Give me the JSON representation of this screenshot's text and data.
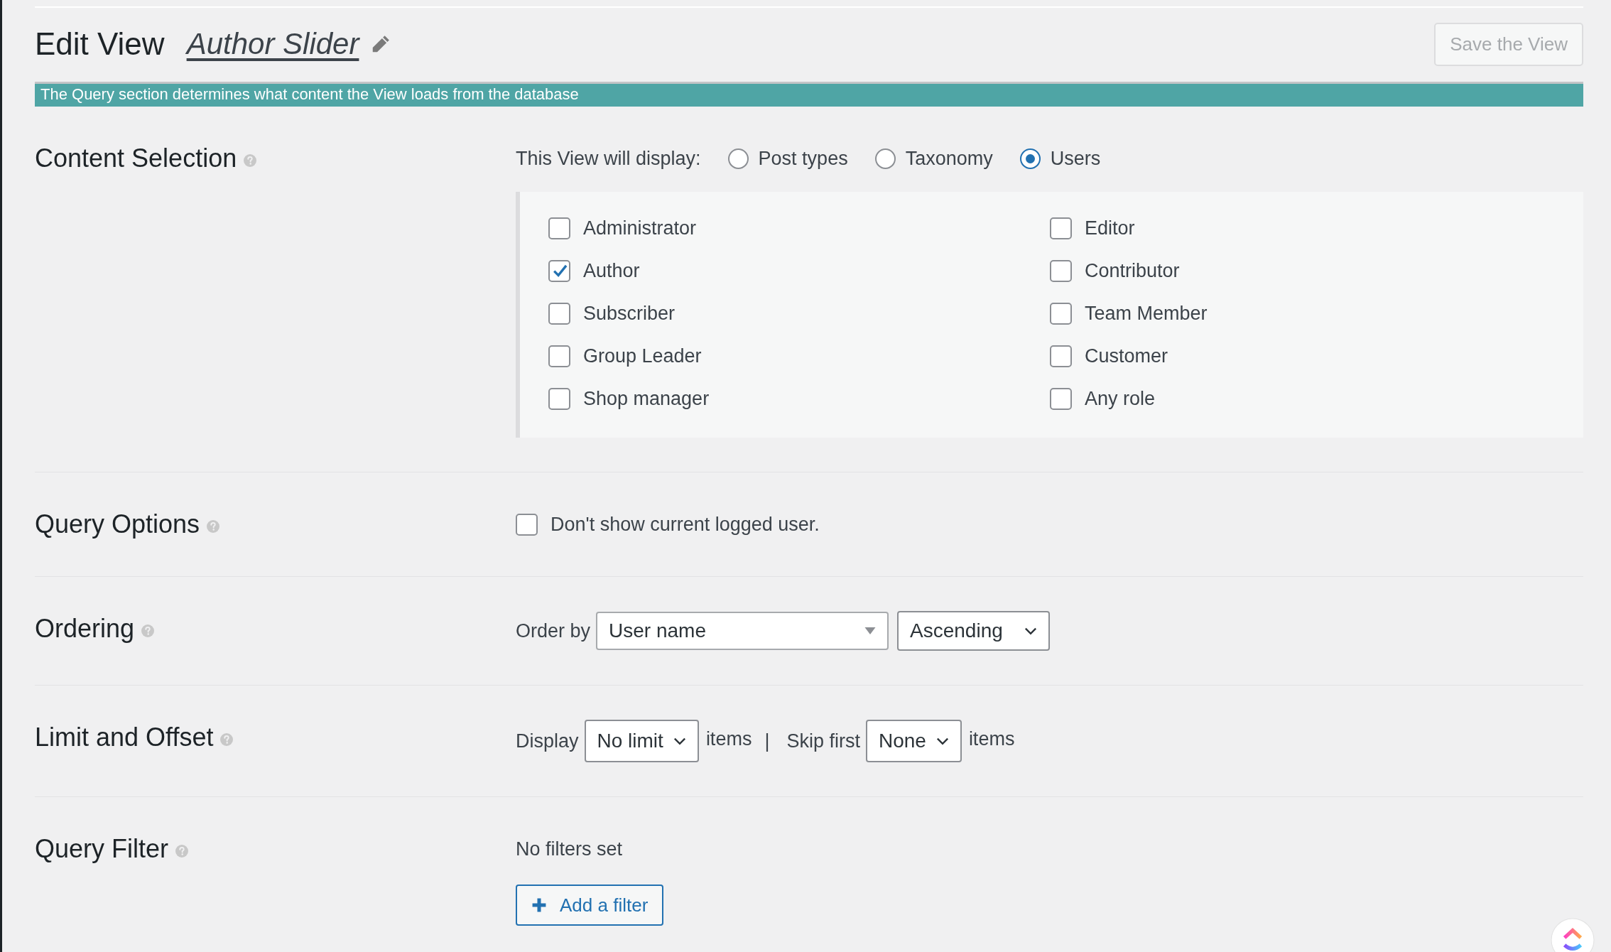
{
  "header": {
    "title": "Edit View",
    "view_name": "Author Slider",
    "save_button": "Save the View"
  },
  "banner": "The Query section determines what content the View loads from the database",
  "content_selection": {
    "label": "Content Selection",
    "display_label": "This View will display:",
    "radios": [
      {
        "label": "Post types",
        "selected": false
      },
      {
        "label": "Taxonomy",
        "selected": false
      },
      {
        "label": "Users",
        "selected": true
      }
    ],
    "roles": [
      {
        "label": "Administrator",
        "checked": false
      },
      {
        "label": "Editor",
        "checked": false
      },
      {
        "label": "Author",
        "checked": true
      },
      {
        "label": "Contributor",
        "checked": false
      },
      {
        "label": "Subscriber",
        "checked": false
      },
      {
        "label": "Team Member",
        "checked": false
      },
      {
        "label": "Group Leader",
        "checked": false
      },
      {
        "label": "Customer",
        "checked": false
      },
      {
        "label": "Shop manager",
        "checked": false
      },
      {
        "label": "Any role",
        "checked": false
      }
    ]
  },
  "query_options": {
    "label": "Query Options",
    "options": [
      {
        "label": "Don't show current logged user.",
        "checked": false
      }
    ]
  },
  "ordering": {
    "label": "Ordering",
    "order_by_label": "Order by",
    "order_by": "User name",
    "direction": "Ascending"
  },
  "limit_offset": {
    "label": "Limit and Offset",
    "display_label": "Display",
    "limit": "No limit",
    "items_label": "items",
    "separator": "|",
    "skip_label": "Skip first",
    "offset": "None",
    "items_label_after_skip": "items"
  },
  "query_filter": {
    "label": "Query Filter",
    "status": "No filters set",
    "add_button": "Add a filter"
  }
}
